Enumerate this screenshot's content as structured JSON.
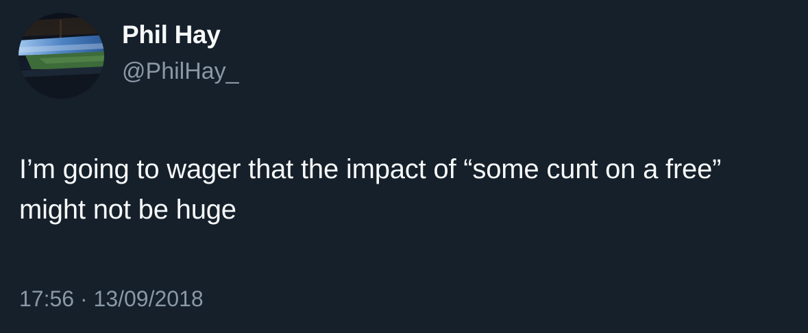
{
  "author": {
    "display_name": "Phil Hay",
    "handle": "@PhilHay_",
    "avatar_icon": "stadium-avatar"
  },
  "tweet": {
    "text": "I’m going to wager that the impact of “some cunt on a free” might not be huge",
    "timestamp": "17:56 · 13/09/2018"
  },
  "colors": {
    "background": "#15202b",
    "primary_text": "#f7f9f9",
    "secondary_text": "#8b98a5"
  }
}
